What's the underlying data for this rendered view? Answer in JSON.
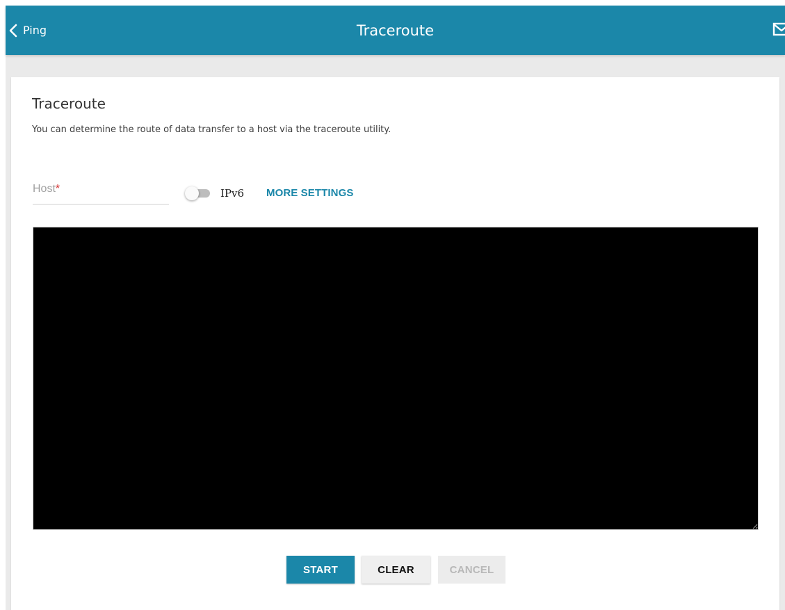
{
  "header": {
    "back_label": "Ping",
    "title": "Traceroute",
    "back_icon": "chevron-left-icon",
    "notifications_icon": "mail-icon",
    "background_color": "#1b87a9"
  },
  "card": {
    "title": "Traceroute",
    "description": "You can determine the route of data transfer to a host via the traceroute utility."
  },
  "form": {
    "host_label": "Host",
    "host_required_mark": "*",
    "host_value": "",
    "ipv6_label": "IPv6",
    "ipv6_enabled": false,
    "more_settings_label": "MORE SETTINGS",
    "output": ""
  },
  "buttons": {
    "start_label": "START",
    "clear_label": "CLEAR",
    "cancel_label": "CANCEL",
    "cancel_disabled": true
  },
  "colors": {
    "accent": "#1b87a9",
    "required": "#d32f2f",
    "terminal_bg": "#000000"
  }
}
